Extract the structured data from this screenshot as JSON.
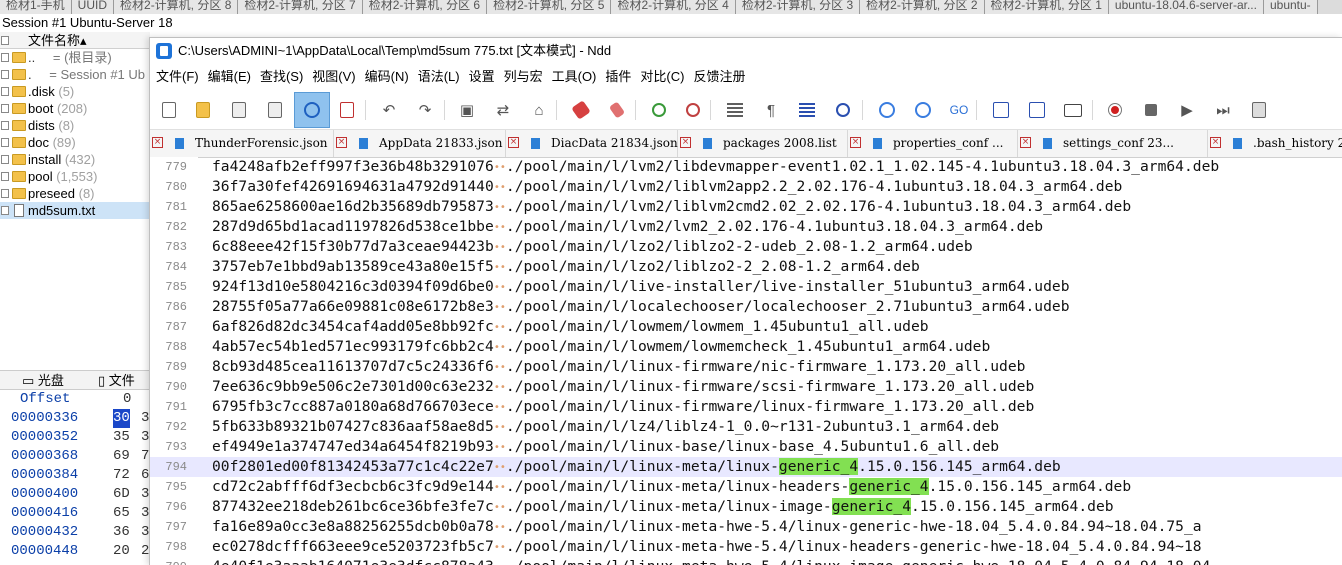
{
  "top_tabs": [
    "检材1-手机",
    "UUID",
    "检材2-计算机, 分区 8",
    "检材2-计算机, 分区 7",
    "检材2-计算机, 分区 6",
    "检材2-计算机, 分区 5",
    "检材2-计算机, 分区 4",
    "检材2-计算机, 分区 3",
    "检材2-计算机, 分区 2",
    "检材2-计算机, 分区 1",
    "ubuntu-18.04.6-server-ar...",
    "ubuntu-"
  ],
  "session_title": "Session #1 Ubuntu-Server 18",
  "left_tree": {
    "header": "文件名称",
    "rows": [
      {
        "name": "..",
        "count": "=    (根目录)",
        "type": "up"
      },
      {
        "name": ".",
        "count": "=    Session #1 Ub",
        "type": "up"
      },
      {
        "name": ".disk",
        "count": "(5)",
        "type": "folder"
      },
      {
        "name": "boot",
        "count": "(208)",
        "type": "folder"
      },
      {
        "name": "dists",
        "count": "(8)",
        "type": "folder"
      },
      {
        "name": "doc",
        "count": "(89)",
        "type": "folder"
      },
      {
        "name": "install",
        "count": "(432)",
        "type": "folder"
      },
      {
        "name": "pool",
        "count": "(1,553)",
        "type": "folder"
      },
      {
        "name": "preseed",
        "count": "(8)",
        "type": "folder"
      },
      {
        "name": "md5sum.txt",
        "count": "",
        "type": "file"
      }
    ]
  },
  "hex_tabs": {
    "disk": "光盘",
    "file": "文件"
  },
  "hex_pane": {
    "offset_label": "Offset",
    "col0": "0",
    "rows": [
      {
        "offset": "00000336",
        "b1": "30",
        "b2": "3"
      },
      {
        "offset": "00000352",
        "b1": "35",
        "b2": "3"
      },
      {
        "offset": "00000368",
        "b1": "69",
        "b2": "7"
      },
      {
        "offset": "00000384",
        "b1": "72",
        "b2": "6"
      },
      {
        "offset": "00000400",
        "b1": "6D",
        "b2": "3"
      },
      {
        "offset": "00000416",
        "b1": "65",
        "b2": "3"
      },
      {
        "offset": "00000432",
        "b1": "36",
        "b2": "3"
      },
      {
        "offset": "00000448",
        "b1": "20",
        "b2": "2"
      }
    ]
  },
  "ndd": {
    "title": "C:\\Users\\ADMINI~1\\AppData\\Local\\Temp\\md5sum 775.txt [文本模式] - Ndd",
    "menu": [
      "文件(F)",
      "编辑(E)",
      "查找(S)",
      "视图(V)",
      "编码(N)",
      "语法(L)",
      "设置",
      "列与宏",
      "工具(O)",
      "插件",
      "对比(C)",
      "反馈注册"
    ],
    "file_tabs": [
      "ThunderForensic.json",
      "AppData 21833.json",
      "DiacData 21834.json",
      "packages 2008.list",
      "properties_conf ...",
      "settings_conf 23...",
      ".bash_history 2"
    ],
    "lines": [
      {
        "n": "779",
        "hash": "fa4248afb2eff997f3e36b48b3291076",
        "pre": "./pool/main/l/lvm2/libdevmapper-event1.02.1_1.02.145-4.1ubuntu3.18.04.3_arm64.deb",
        "hl": "",
        "post": ""
      },
      {
        "n": "780",
        "hash": "36f7a30fef42691694631a4792d91440",
        "pre": "./pool/main/l/lvm2/liblvm2app2.2_2.02.176-4.1ubuntu3.18.04.3_arm64.deb",
        "hl": "",
        "post": ""
      },
      {
        "n": "781",
        "hash": "865ae6258600ae16d2b35689db795873",
        "pre": "./pool/main/l/lvm2/liblvm2cmd2.02_2.02.176-4.1ubuntu3.18.04.3_arm64.deb",
        "hl": "",
        "post": ""
      },
      {
        "n": "782",
        "hash": "287d9d65bd1acad1197826d538ce1bbe",
        "pre": "./pool/main/l/lvm2/lvm2_2.02.176-4.1ubuntu3.18.04.3_arm64.deb",
        "hl": "",
        "post": ""
      },
      {
        "n": "783",
        "hash": "6c88eee42f15f30b77d7a3ceae94423b",
        "pre": "./pool/main/l/lzo2/liblzo2-2-udeb_2.08-1.2_arm64.udeb",
        "hl": "",
        "post": ""
      },
      {
        "n": "784",
        "hash": "3757eb7e1bbd9ab13589ce43a80e15f5",
        "pre": "./pool/main/l/lzo2/liblzo2-2_2.08-1.2_arm64.deb",
        "hl": "",
        "post": ""
      },
      {
        "n": "785",
        "hash": "924f13d10e5804216c3d0394f09d6be0",
        "pre": "./pool/main/l/live-installer/live-installer_51ubuntu3_arm64.udeb",
        "hl": "",
        "post": ""
      },
      {
        "n": "786",
        "hash": "28755f05a77a66e09881c08e6172b8e3",
        "pre": "./pool/main/l/localechooser/localechooser_2.71ubuntu3_arm64.udeb",
        "hl": "",
        "post": ""
      },
      {
        "n": "787",
        "hash": "6af826d82dc3454caf4add05e8bb92fc",
        "pre": "./pool/main/l/lowmem/lowmem_1.45ubuntu1_all.udeb",
        "hl": "",
        "post": ""
      },
      {
        "n": "788",
        "hash": "4ab57ec54b1ed571ec993179fc6bb2c4",
        "pre": "./pool/main/l/lowmem/lowmemcheck_1.45ubuntu1_arm64.udeb",
        "hl": "",
        "post": ""
      },
      {
        "n": "789",
        "hash": "8cb93d485cea11613707d7c5c24336f6",
        "pre": "./pool/main/l/linux-firmware/nic-firmware_1.173.20_all.udeb",
        "hl": "",
        "post": ""
      },
      {
        "n": "790",
        "hash": "7ee636c9bb9e506c2e7301d00c63e232",
        "pre": "./pool/main/l/linux-firmware/scsi-firmware_1.173.20_all.udeb",
        "hl": "",
        "post": ""
      },
      {
        "n": "791",
        "hash": "6795fb3c7cc887a0180a68d766703ece",
        "pre": "./pool/main/l/linux-firmware/linux-firmware_1.173.20_all.deb",
        "hl": "",
        "post": ""
      },
      {
        "n": "792",
        "hash": "5fb633b89321b07427c836aaf58ae8d5",
        "pre": "./pool/main/l/lz4/liblz4-1_0.0~r131-2ubuntu3.1_arm64.deb",
        "hl": "",
        "post": ""
      },
      {
        "n": "793",
        "hash": "ef4949e1a374747ed34a6454f8219b93",
        "pre": "./pool/main/l/linux-base/linux-base_4.5ubuntu1.6_all.deb",
        "hl": "",
        "post": ""
      },
      {
        "n": "794",
        "hash": "00f2801ed00f81342453a77c1c4c22e7",
        "pre": "./pool/main/l/linux-meta/linux-",
        "hl": "generic_4",
        "post": ".15.0.156.145_arm64.deb"
      },
      {
        "n": "795",
        "hash": "cd72c2abfff6df3ecbcb6c3fc9d9e144",
        "pre": "./pool/main/l/linux-meta/linux-headers-",
        "hl": "generic_4",
        "post": ".15.0.156.145_arm64.deb"
      },
      {
        "n": "796",
        "hash": "877432ee218deb261bc6ce36bfe3fe7c",
        "pre": "./pool/main/l/linux-meta/linux-image-",
        "hl": "generic_4",
        "post": ".15.0.156.145_arm64.deb"
      },
      {
        "n": "797",
        "hash": "fa16e89a0cc3e8a88256255dcb0b0a78",
        "pre": "./pool/main/l/linux-meta-hwe-5.4/linux-generic-hwe-18.04_5.4.0.84.94~18.04.75_a",
        "hl": "",
        "post": ""
      },
      {
        "n": "798",
        "hash": "ec0278dcfff663eee9ce5203723fb5c7",
        "pre": "./pool/main/l/linux-meta-hwe-5.4/linux-headers-generic-hwe-18.04_5.4.0.84.94~18",
        "hl": "",
        "post": ""
      },
      {
        "n": "799",
        "hash": "4e40f1e3aaab164071e3e3dfcc878a43",
        "pre": "./pool/main/l/linux-meta-hwe-5.4/linux-image-generic-hwe-18.04_5.4.0.84.94~18.04",
        "hl": "",
        "post": ""
      }
    ],
    "current_line": "794"
  }
}
